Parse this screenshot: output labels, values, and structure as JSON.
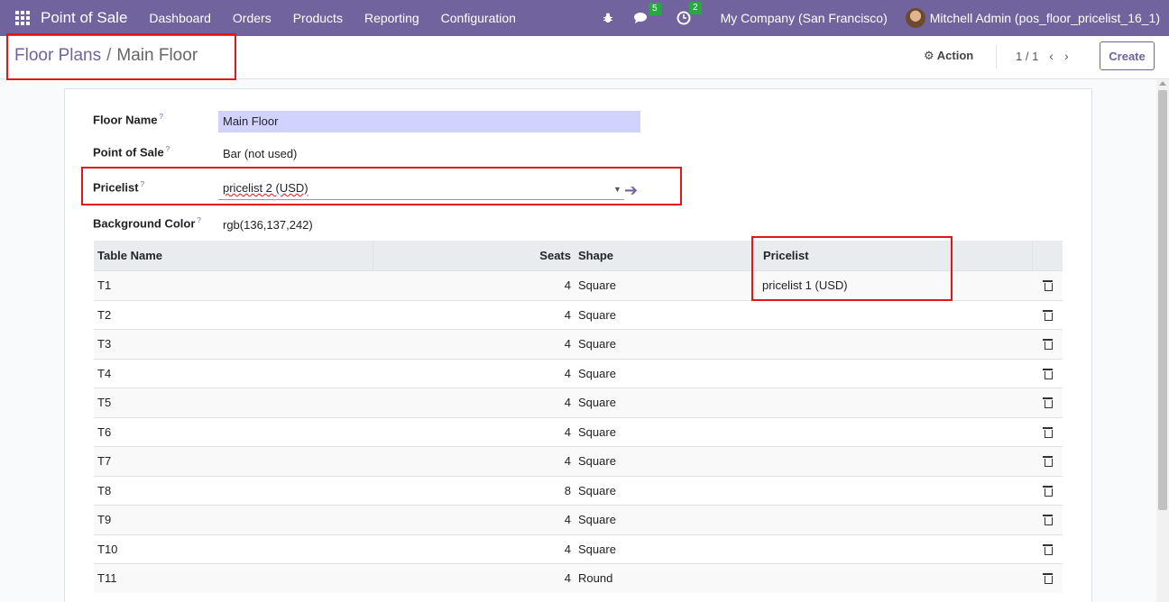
{
  "navbar": {
    "brand": "Point of Sale",
    "menu": [
      "Dashboard",
      "Orders",
      "Products",
      "Reporting",
      "Configuration"
    ],
    "messages_count": "5",
    "activities_count": "2",
    "company": "My Company (San Francisco)",
    "user": "Mitchell Admin (pos_floor_pricelist_16_1)",
    "colors": {
      "primary": "#71639e",
      "badge": "#28a745",
      "highlight": "#e0161b"
    }
  },
  "control_panel": {
    "breadcrumb_parent": "Floor Plans",
    "breadcrumb_separator": "/",
    "breadcrumb_current": "Main Floor",
    "action_label": "Action",
    "pager": "1 / 1",
    "create_label": "Create"
  },
  "form": {
    "floor_name": {
      "label": "Floor Name",
      "help": "?",
      "value": "Main Floor"
    },
    "point_of_sale": {
      "label": "Point of Sale",
      "help": "?",
      "value": "Bar (not used)"
    },
    "pricelist": {
      "label": "Pricelist",
      "help": "?",
      "value": "pricelist 2 (USD)"
    },
    "background_color": {
      "label": "Background Color",
      "help": "?",
      "value": "rgb(136,137,242)"
    }
  },
  "table": {
    "headers": {
      "name": "Table Name",
      "seats": "Seats",
      "shape": "Shape",
      "pricelist": "Pricelist"
    },
    "rows": [
      {
        "name": "T1",
        "seats": "4",
        "shape": "Square",
        "pricelist": "pricelist 1 (USD)"
      },
      {
        "name": "T2",
        "seats": "4",
        "shape": "Square",
        "pricelist": ""
      },
      {
        "name": "T3",
        "seats": "4",
        "shape": "Square",
        "pricelist": ""
      },
      {
        "name": "T4",
        "seats": "4",
        "shape": "Square",
        "pricelist": ""
      },
      {
        "name": "T5",
        "seats": "4",
        "shape": "Square",
        "pricelist": ""
      },
      {
        "name": "T6",
        "seats": "4",
        "shape": "Square",
        "pricelist": ""
      },
      {
        "name": "T7",
        "seats": "4",
        "shape": "Square",
        "pricelist": ""
      },
      {
        "name": "T8",
        "seats": "8",
        "shape": "Square",
        "pricelist": ""
      },
      {
        "name": "T9",
        "seats": "4",
        "shape": "Square",
        "pricelist": ""
      },
      {
        "name": "T10",
        "seats": "4",
        "shape": "Square",
        "pricelist": ""
      },
      {
        "name": "T11",
        "seats": "4",
        "shape": "Round",
        "pricelist": ""
      }
    ]
  }
}
